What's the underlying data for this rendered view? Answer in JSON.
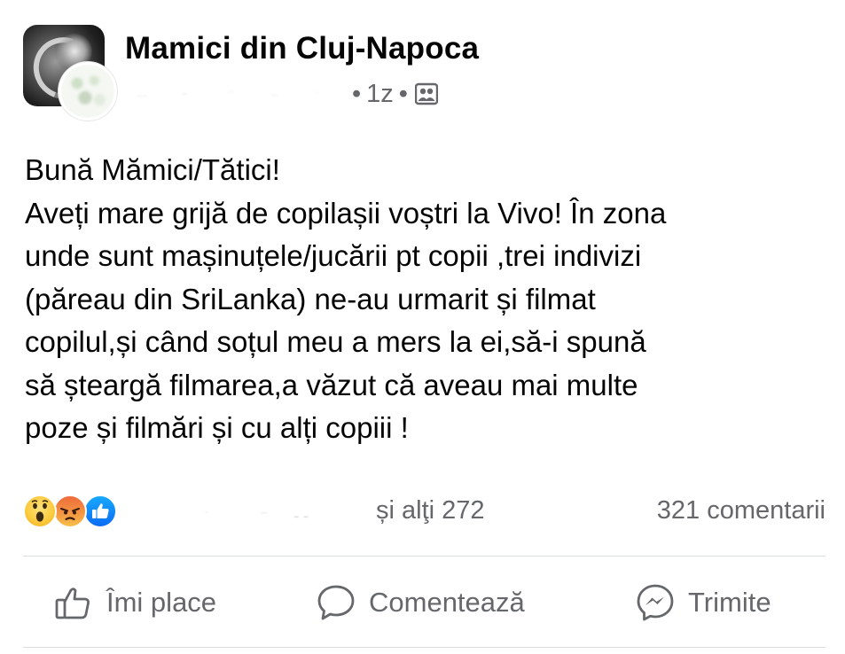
{
  "header": {
    "group_name": "Mamici din Cluj-Napoca",
    "time": "1z",
    "separator": "•",
    "audience_icon": "group-members-icon",
    "group_avatar_icon": "group-avatar",
    "user_avatar_icon": "user-avatar"
  },
  "post": {
    "lines": [
      "Bună Mămici/Tătici!",
      "Aveți mare grijă de copilașii voștri la Vivo! În zona",
      "unde sunt mașinuțele/jucării pt copii ,trei indivizi",
      "(păreau din SriLanka) ne-au urmarit și filmat",
      "copilul,și când soțul meu a mers la ei,să-i spună",
      "să șteargă filmarea,a văzut că aveau mai multe",
      "poze și filmări și cu alți copiii !"
    ]
  },
  "reactions": {
    "icons": [
      "wow-icon",
      "angry-icon",
      "like-icon"
    ],
    "others": "și alţi 272",
    "comments": "321 comentarii"
  },
  "actions": {
    "like_label": "Îmi place",
    "comment_label": "Comentează",
    "share_label": "Trimite"
  },
  "colors": {
    "text": "#050505",
    "secondary": "#65676b",
    "divider": "#dadde1",
    "like_blue": "#0b6cf5"
  }
}
